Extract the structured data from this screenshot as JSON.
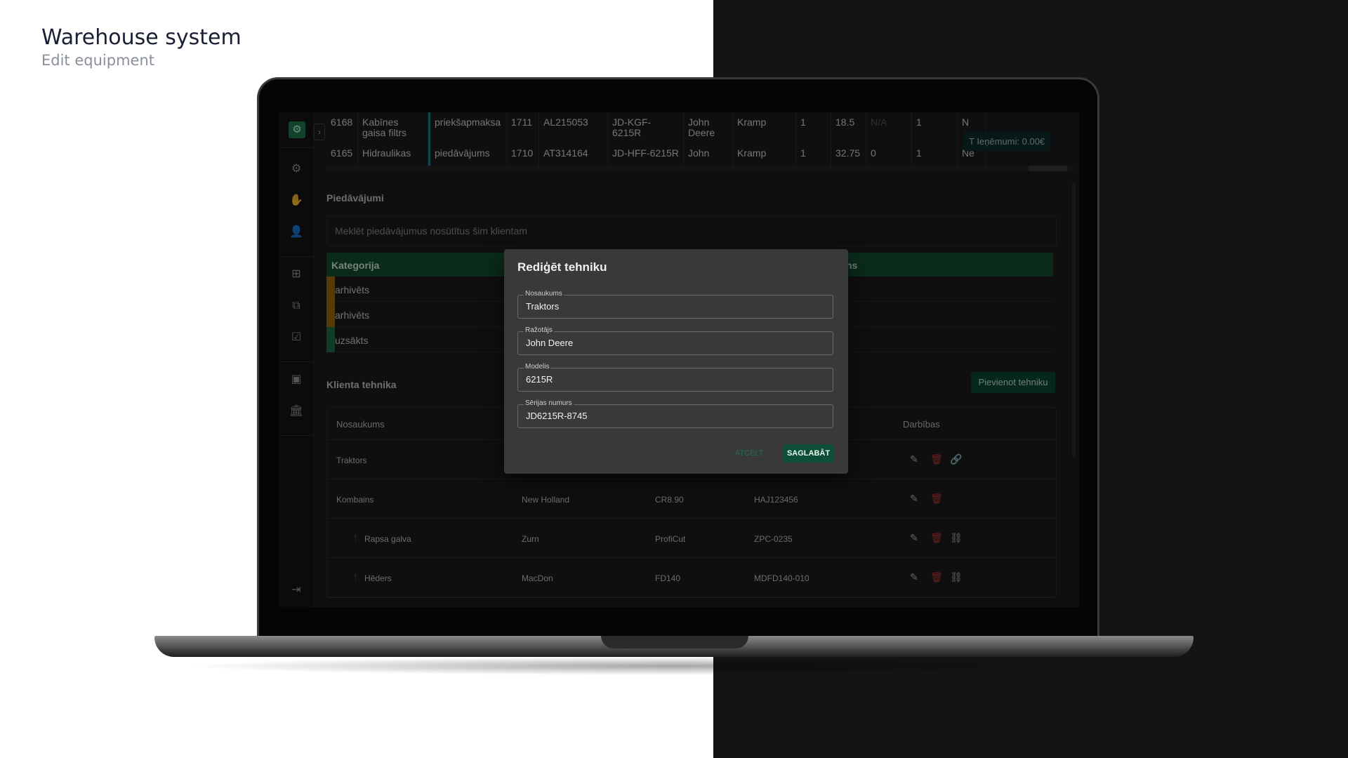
{
  "caption": {
    "title": "Warehouse system",
    "subtitle": "Edit equipment"
  },
  "colors": {
    "accent": "#0c4f36",
    "category_header": "#134f33",
    "danger": "#c73a3a",
    "archived": "#a06b0f",
    "started": "#1f6e4b"
  },
  "sidebar": {
    "icons": [
      "logo-icon",
      "gear-icon",
      "handshake-icon",
      "user-icon",
      "add-box-icon",
      "add-copy-icon",
      "check-box-icon",
      "wallet-icon",
      "bank-icon",
      "logout-icon"
    ],
    "expand_label": "›"
  },
  "top_table": {
    "rows": [
      [
        "6168",
        "Kabīnes gaisa filtrs",
        "priekšapmaksa",
        "1711",
        "AL215053",
        "JD-KGF-6215R",
        "John Deere",
        "Kramp",
        "1",
        "18.5",
        "N/A",
        "1",
        "N"
      ],
      [
        "6165",
        "Hidraulikas",
        "piedāvājums",
        "1710",
        "AT314164",
        "JD-HFF-6215R",
        "John",
        "Kramp",
        "1",
        "32.75",
        "0",
        "1",
        "Ne"
      ]
    ],
    "totals": "T Ieņēmumi: 0.00€"
  },
  "offers": {
    "title": "Piedāvājumi",
    "search_placeholder": "Meklēt piedāvājumus nosūtītus šim klientam",
    "column_header": "Kategorija",
    "column_header_right": "ns",
    "rows": [
      {
        "label": "arhivēts",
        "status": "archived"
      },
      {
        "label": "arhivēts",
        "status": "archived"
      },
      {
        "label": "uzsākts",
        "status": "started"
      }
    ]
  },
  "equipment": {
    "title": "Klienta tehnika",
    "add_button": "Pievienot tehniku",
    "headers": {
      "name": "Nosaukums",
      "actions": "Darbības"
    },
    "rows": [
      {
        "name": "Traktors",
        "manufacturer": "",
        "model": "",
        "serial": "",
        "child": false,
        "link": "link"
      },
      {
        "name": "Kombains",
        "manufacturer": "New Holland",
        "model": "CR8.90",
        "serial": "HAJ123456",
        "child": false,
        "link": ""
      },
      {
        "name": "Rapsa galva",
        "manufacturer": "Zurn",
        "model": "ProfiCut",
        "serial": "ZPC-0235",
        "child": true,
        "link": "unlink"
      },
      {
        "name": "Hēders",
        "manufacturer": "MacDon",
        "model": "FD140",
        "serial": "MDFD140-010",
        "child": true,
        "link": "unlink"
      }
    ]
  },
  "dialog": {
    "title": "Rediģēt tehniku",
    "fields": [
      {
        "label": "Nosaukums",
        "value": "Traktors"
      },
      {
        "label": "Ražotājs",
        "value": "John Deere"
      },
      {
        "label": "Modelis",
        "value": "6215R"
      },
      {
        "label": "Sērijas numurs",
        "value": "JD6215R-8745"
      }
    ],
    "cancel": "ATCELT",
    "save": "SAGLABĀT"
  }
}
